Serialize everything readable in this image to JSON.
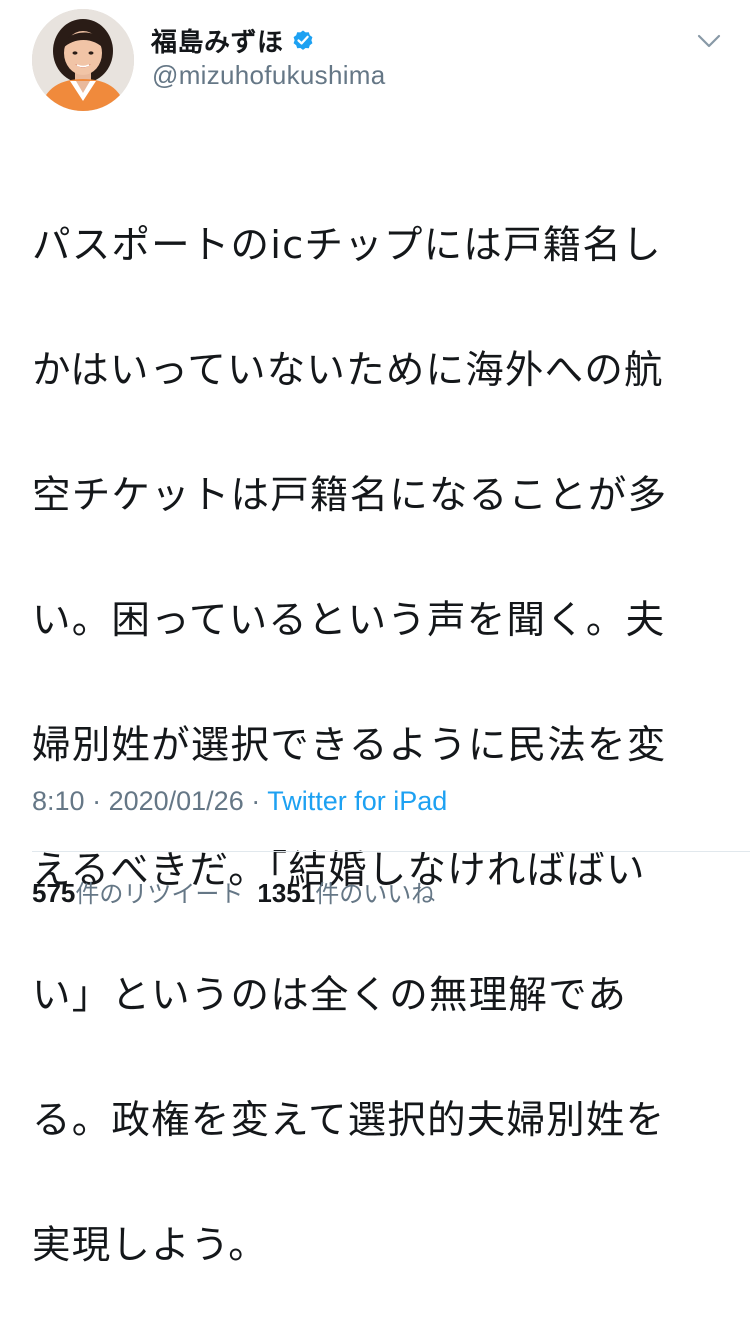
{
  "user": {
    "display_name": "福島みずほ",
    "handle": "@mizuhofukushima",
    "verified": true,
    "avatar_icon": "profile-photo"
  },
  "tweet": {
    "text_lines": [
      "パスポートのicチップには戸籍名し",
      "かはいっていないために海外への航",
      "空チケットは戸籍名になることが多",
      "い。困っているという声を聞く。夫",
      "婦別姓が選択できるように民法を変",
      "えるべきだ。「結婚しなければばい",
      "い」というのは全くの無理解であ",
      "る。政権を変えて選択的夫婦別姓を",
      "実現しよう。"
    ]
  },
  "meta": {
    "time": "8:10",
    "separator": "·",
    "date": "2020/01/26",
    "source": "Twitter for iPad"
  },
  "stats": {
    "retweets_count": "575",
    "retweets_label": "件のリツイート",
    "likes_count": "1351",
    "likes_label": "件のいいね"
  },
  "colors": {
    "text": "#14171a",
    "muted": "#657786",
    "accent": "#1da1f2",
    "divider": "#e1e8ed"
  }
}
